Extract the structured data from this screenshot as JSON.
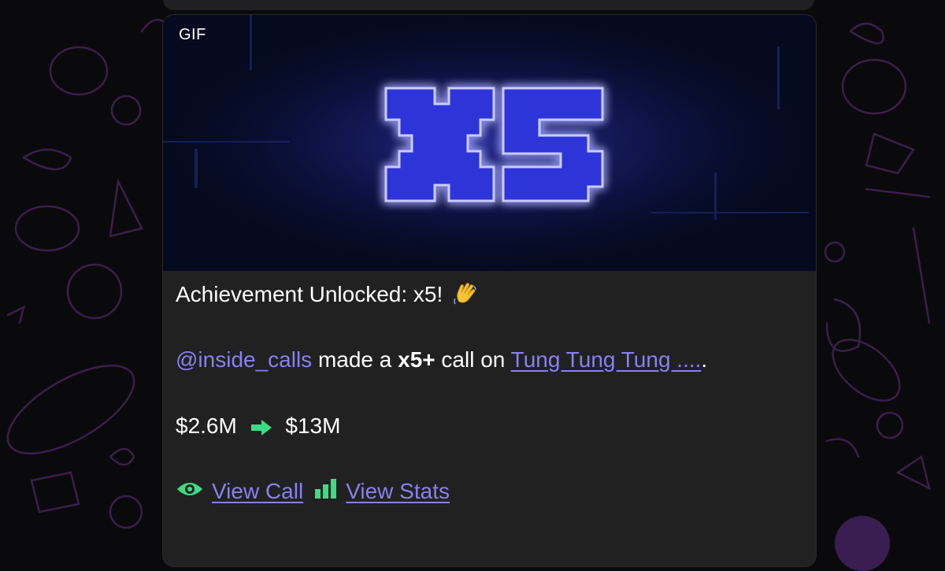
{
  "gif": {
    "badge": "GIF",
    "graphic_text": "x5"
  },
  "message": {
    "title": "Achievement Unlocked: x5!",
    "title_emoji": "waving-hand",
    "mention": "@inside_calls",
    "made_a": " made a ",
    "multiplier": "x5+",
    "call_on": " call on ",
    "token_link": "Tung Tung Tung ....",
    "period": ".",
    "market_cap_from": "$2.6M",
    "market_cap_to": "$13M",
    "view_call_label": "View Call",
    "view_stats_label": "View Stats"
  },
  "colors": {
    "bubble_bg": "#212121",
    "link": "#8a7ff0",
    "accent_green": "#3ddc84",
    "neon_blue": "#6a6cff"
  }
}
